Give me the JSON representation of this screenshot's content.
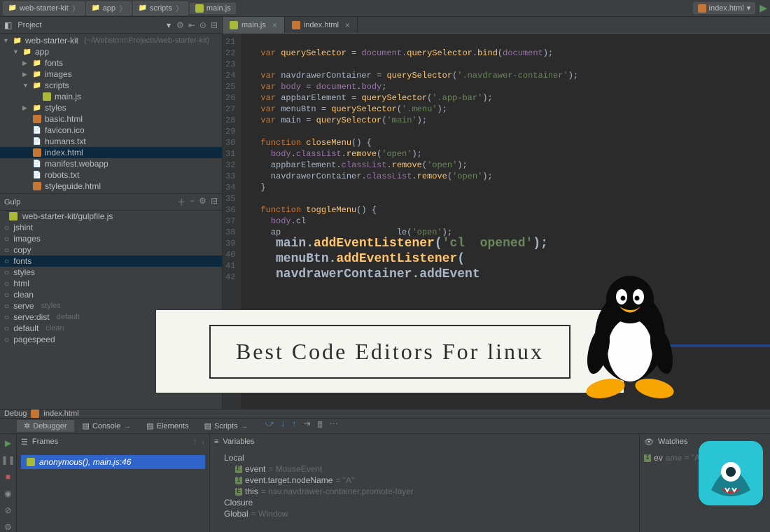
{
  "breadcrumb": [
    {
      "label": "web-starter-kit",
      "icon": "folder"
    },
    {
      "label": "app",
      "icon": "folder"
    },
    {
      "label": "scripts",
      "icon": "folder"
    },
    {
      "label": "main.js",
      "icon": "js"
    }
  ],
  "top_right": {
    "file_dropdown": "index.html",
    "run_hint": "Run"
  },
  "project_panel": {
    "title": "Project",
    "tree": [
      {
        "depth": 0,
        "arrow": "down",
        "icon": "folder",
        "label": "web-starter-kit",
        "hint": "(~/WebstormProjects/web-starter-kit)"
      },
      {
        "depth": 1,
        "arrow": "down",
        "icon": "folder",
        "label": "app"
      },
      {
        "depth": 2,
        "arrow": "right",
        "icon": "folder",
        "label": "fonts"
      },
      {
        "depth": 2,
        "arrow": "right",
        "icon": "folder",
        "label": "images"
      },
      {
        "depth": 2,
        "arrow": "down",
        "icon": "folder",
        "label": "scripts"
      },
      {
        "depth": 3,
        "arrow": "none",
        "icon": "js",
        "label": "main.js"
      },
      {
        "depth": 2,
        "arrow": "right",
        "icon": "folder",
        "label": "styles"
      },
      {
        "depth": 2,
        "arrow": "none",
        "icon": "html",
        "label": "basic.html"
      },
      {
        "depth": 2,
        "arrow": "none",
        "icon": "file",
        "label": "favicon.ico"
      },
      {
        "depth": 2,
        "arrow": "none",
        "icon": "file",
        "label": "humans.txt"
      },
      {
        "depth": 2,
        "arrow": "none",
        "icon": "html",
        "label": "index.html",
        "selected": true
      },
      {
        "depth": 2,
        "arrow": "none",
        "icon": "file",
        "label": "manifest.webapp"
      },
      {
        "depth": 2,
        "arrow": "none",
        "icon": "file",
        "label": "robots.txt"
      },
      {
        "depth": 2,
        "arrow": "none",
        "icon": "html",
        "label": "styleguide.html"
      }
    ]
  },
  "gulp_panel": {
    "title": "Gulp",
    "file": "web-starter-kit/gulpfile.js",
    "tasks": [
      {
        "label": "jshint"
      },
      {
        "label": "images"
      },
      {
        "label": "copy"
      },
      {
        "label": "fonts",
        "selected": true
      },
      {
        "label": "styles"
      },
      {
        "label": "html"
      },
      {
        "label": "clean"
      },
      {
        "label": "serve",
        "hint": "styles"
      },
      {
        "label": "serve:dist",
        "hint": "default"
      },
      {
        "label": "default",
        "hint": "clean"
      },
      {
        "label": "pagespeed"
      }
    ]
  },
  "editor": {
    "tabs": [
      {
        "label": "main.js",
        "icon": "js",
        "active": true
      },
      {
        "label": "index.html",
        "icon": "html",
        "active": false
      }
    ],
    "first_line_no": 21,
    "lines": [
      "",
      "var querySelector = document.querySelector.bind(document);",
      "",
      "var navdrawerContainer = querySelector('.navdrawer-container');",
      "var body = document.body;",
      "var appbarElement = querySelector('.app-bar');",
      "var menuBtn = querySelector('.menu');",
      "var main = querySelector('main');",
      "",
      "function closeMenu() {",
      "  body.classList.remove('open');",
      "  appbarElement.classList.remove('open');",
      "  navdrawerContainer.classList.remove('open');",
      "}",
      "",
      "function toggleMenu() {",
      "  body.cl",
      "  ap                       le('open');",
      "  main.addEventListener('cl  opened');",
      "  menuBtn.addEventListener(",
      "  navdrawerContainer.addEvent",
      ""
    ]
  },
  "banner": {
    "text": "Best Code Editors For linux"
  },
  "debug": {
    "title_prefix": "Debug",
    "title_file": "index.html",
    "tabs": [
      {
        "label": "Debugger",
        "active": true
      },
      {
        "label": "Console",
        "active": false
      },
      {
        "label": "Elements",
        "active": false
      },
      {
        "label": "Scripts",
        "active": false
      }
    ],
    "frames": {
      "title": "Frames",
      "current": "anonymous(), main.js:46"
    },
    "variables": {
      "title": "Variables",
      "items": [
        {
          "depth": 0,
          "arrow": "down",
          "label": "Local"
        },
        {
          "depth": 1,
          "arrow": "right",
          "badge": "E",
          "label": "event",
          "value": "= MouseEvent"
        },
        {
          "depth": 1,
          "arrow": "none",
          "badge": "I",
          "label": "event.target.nodeName",
          "value": "= \"A\""
        },
        {
          "depth": 1,
          "arrow": "right",
          "badge": "E",
          "label": "this",
          "value": "= nav.navdrawer-container.promote-layer"
        },
        {
          "depth": 0,
          "arrow": "right",
          "label": "Closure"
        },
        {
          "depth": 0,
          "arrow": "right",
          "label": "Global",
          "value": "= Window"
        }
      ]
    },
    "watches": {
      "title": "Watches",
      "item": {
        "label": "ev",
        "value": "ame = \"A\""
      }
    }
  }
}
